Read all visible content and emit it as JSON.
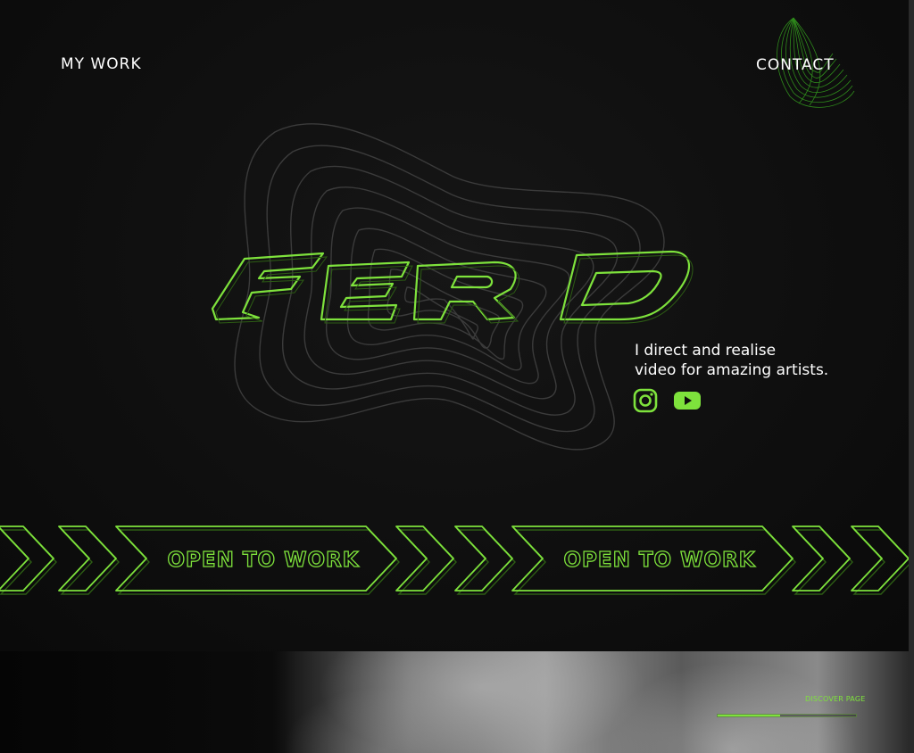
{
  "nav": {
    "my_work": "MY WORK",
    "contact": "CONTACT"
  },
  "hero": {
    "logo_text": "FERD",
    "tagline_line1": "I direct and realise",
    "tagline_line2": "video for amazing artists."
  },
  "social": [
    {
      "icon": "instagram-icon"
    },
    {
      "icon": "youtube-icon"
    }
  ],
  "banner": {
    "text": "OPEN TO WORK"
  },
  "photo_section": {
    "discover_label": "DISCOVER PAGE",
    "progress": 0.45
  },
  "colors": {
    "accent": "#7ee23c",
    "background": "#0d0d0d",
    "text": "#ffffff",
    "wave_lines": "#3a3a3a"
  }
}
